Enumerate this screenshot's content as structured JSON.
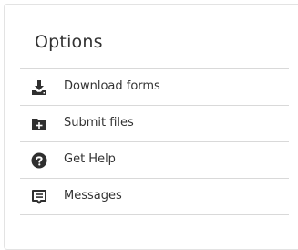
{
  "panel": {
    "title": "Options"
  },
  "menu": {
    "items": [
      {
        "label": "Download forms",
        "icon": "download-icon"
      },
      {
        "label": "Submit files",
        "icon": "folder-plus-icon"
      },
      {
        "label": "Get Help",
        "icon": "help-circle-icon"
      },
      {
        "label": "Messages",
        "icon": "message-icon"
      }
    ]
  },
  "colors": {
    "icon": "#2f2f2f",
    "text": "#333333",
    "divider": "#d9d9d9",
    "border": "#e3e3e3"
  }
}
